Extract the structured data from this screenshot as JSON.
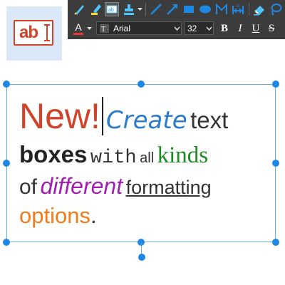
{
  "app_icon": {
    "label": "ab",
    "name": "text-box-tool"
  },
  "toolbar": {
    "row1": [
      {
        "name": "pen-icon",
        "color": "#4fc3f7"
      },
      {
        "name": "highlighter-icon",
        "color": "#4fc3f7"
      },
      {
        "name": "text-box-icon",
        "color": "#4fc3f7",
        "active": true
      },
      {
        "name": "stamp-icon",
        "color": "#4fc3f7"
      },
      {
        "name": "line-icon",
        "color": "#1e88e5"
      },
      {
        "name": "arrow-icon",
        "color": "#1e88e5"
      },
      {
        "name": "rectangle-icon",
        "color": "#1e88e5"
      },
      {
        "name": "ellipse-icon",
        "color": "#1e88e5"
      },
      {
        "name": "polyline-icon",
        "color": "#1e88e5"
      },
      {
        "name": "measure-icon",
        "color": "#1e88e5"
      },
      {
        "name": "eraser-icon",
        "color": "#4fc3f7"
      },
      {
        "name": "lasso-icon",
        "color": "#1e88e5"
      }
    ],
    "text_color_label": "A",
    "text_color": "#e53935",
    "font": {
      "value": "Arial"
    },
    "size": {
      "value": "32"
    },
    "bold_label": "B",
    "italic_label": "I",
    "underline_label": "U",
    "strike_label": "S"
  },
  "textbox": {
    "new": "New!",
    "create": "Create",
    "text": "text",
    "boxes": "boxes",
    "with": "with",
    "all": "all",
    "kinds": "kinds",
    "of": "of",
    "different": "different",
    "formatting": "formatting",
    "options": "options",
    "period": "."
  },
  "colors": {
    "accent": "#1e88e5",
    "selection_border": "#6aaee8",
    "red": "#d0422a",
    "blue": "#2b7bc8",
    "green": "#1e8a22",
    "purple": "#a11eb0",
    "orange": "#f07a1c"
  }
}
